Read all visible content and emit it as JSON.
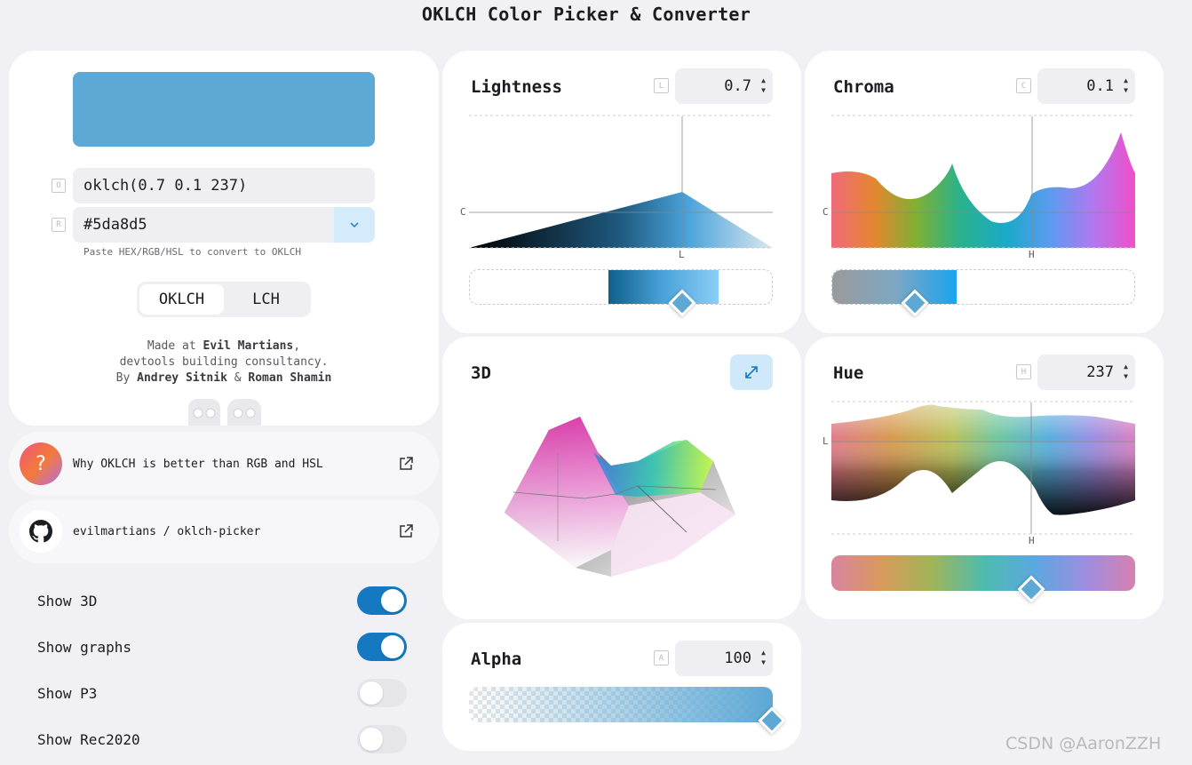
{
  "app_title": "OKLCH Color Picker & Converter",
  "color": {
    "hex": "#5da8d5"
  },
  "inputs": {
    "oklch_tag": "O",
    "oklch_value": "oklch(0.7 0.1 237)",
    "hex_tag": "R",
    "hex_value": "#5da8d5",
    "hint": "Paste HEX/RGB/HSL to convert to OKLCH"
  },
  "mode_switch": {
    "options": [
      "OKLCH",
      "LCH"
    ],
    "selected": "OKLCH"
  },
  "credits": {
    "line1_pre": "Made at ",
    "line1_bold": "Evil Martians",
    "line1_post": ",",
    "line2": "devtools building consultancy.",
    "line3_pre": "By ",
    "author1": "Andrey Sitnik",
    "amp": " & ",
    "author2": "Roman Shamin"
  },
  "links": {
    "why_icon": "?",
    "why_label": "Why OKLCH is better than RGB and HSL",
    "github_label": "evilmartians / oklch-picker"
  },
  "toggles": [
    {
      "label": "Show 3D",
      "on": true
    },
    {
      "label": "Show graphs",
      "on": true
    },
    {
      "label": "Show P3",
      "on": false
    },
    {
      "label": "Show Rec2020",
      "on": false
    }
  ],
  "panels": {
    "lightness": {
      "title": "Lightness",
      "tag": "L",
      "value": "0.7",
      "axis_y": "C",
      "axis_x": "L",
      "fraction": 0.7
    },
    "chroma": {
      "title": "Chroma",
      "tag": "C",
      "value": "0.1",
      "axis_y": "C",
      "axis_x": "H",
      "fraction": 0.27
    },
    "three_d": {
      "title": "3D"
    },
    "hue": {
      "title": "Hue",
      "tag": "H",
      "value": "237",
      "axis_y": "L",
      "axis_x": "H",
      "fraction": 0.658
    },
    "alpha": {
      "title": "Alpha",
      "tag": "A",
      "value": "100",
      "fraction": 1.0
    }
  },
  "watermark": "CSDN @AaronZZH"
}
